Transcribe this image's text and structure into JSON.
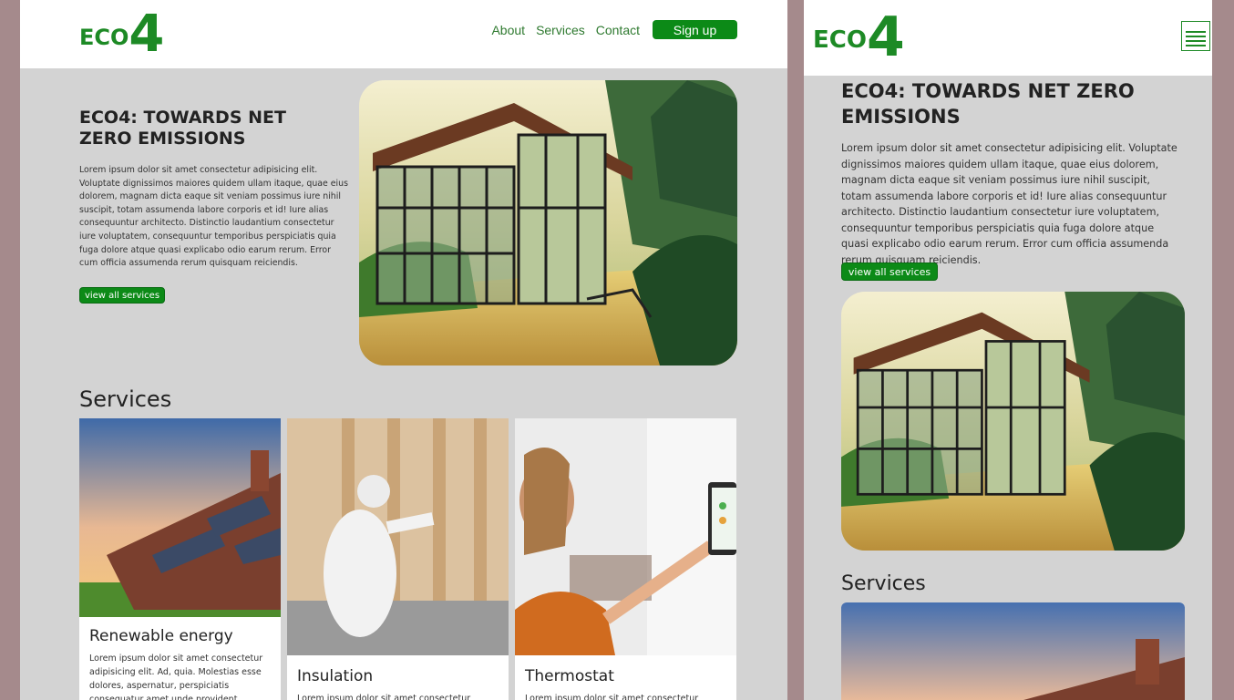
{
  "brand": {
    "eco": "ECO",
    "four": "4",
    "color": "#1d8a25"
  },
  "nav": {
    "about": "About",
    "services": "Services",
    "contact": "Contact",
    "signup": "Sign up"
  },
  "hero": {
    "title": "ECO4: TOWARDS NET ZERO EMISSIONS",
    "text": "Lorem ipsum dolor sit amet consectetur adipisicing elit. Voluptate dignissimos maiores quidem ullam itaque, quae eius dolorem, magnam dicta eaque sit veniam possimus iure nihil suscipit, totam assumenda labore corporis et id! Iure alias consequuntur architecto. Distinctio laudantium consectetur iure voluptatem, consequuntur temporibus perspiciatis quia fuga dolore atque quasi explicabo odio earum rerum. Error cum officia assumenda rerum quisquam reiciendis.",
    "button": "view all services"
  },
  "services": {
    "heading": "Services",
    "cards": [
      {
        "title": "Renewable energy",
        "text": "Lorem ipsum dolor sit amet consectetur adipisicing elit. Ad, quia. Molestias esse dolores, aspernatur, perspiciatis consequatur amet unde provident",
        "icon": "solar-roof-image"
      },
      {
        "title": "Insulation",
        "text": "Lorem ipsum dolor sit amet consectetur",
        "icon": "insulation-worker-image"
      },
      {
        "title": "Thermostat",
        "text": "Lorem ipsum dolor sit amet consectetur",
        "icon": "thermostat-woman-image"
      }
    ]
  },
  "colors": {
    "accent": "#0c8a17",
    "page_bg": "#d3d3d3",
    "frame_bg": "#a58a8c"
  }
}
